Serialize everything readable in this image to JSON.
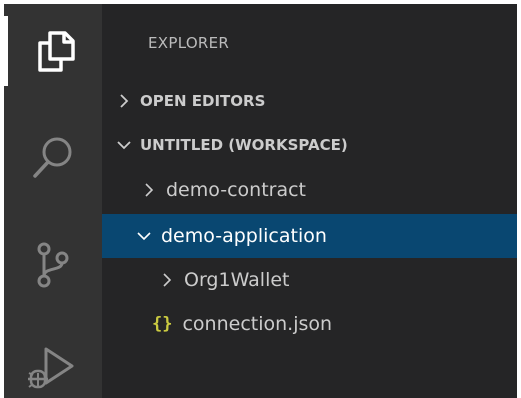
{
  "activity_bar": {
    "items": [
      {
        "name": "explorer",
        "icon": "files-icon",
        "active": true
      },
      {
        "name": "search",
        "icon": "search-icon",
        "active": false
      },
      {
        "name": "source-control",
        "icon": "source-control-icon",
        "active": false
      },
      {
        "name": "run-debug",
        "icon": "run-debug-icon",
        "active": false
      }
    ]
  },
  "sidebar": {
    "title": "EXPLORER",
    "sections": [
      {
        "label": "OPEN EDITORS",
        "expanded": false
      },
      {
        "label": "UNTITLED (WORKSPACE)",
        "expanded": true
      }
    ],
    "tree": [
      {
        "label": "demo-contract",
        "type": "folder",
        "expanded": false,
        "depth": 1
      },
      {
        "label": "demo-application",
        "type": "folder",
        "expanded": true,
        "depth": 1,
        "selected": true
      },
      {
        "label": "Org1Wallet",
        "type": "folder",
        "expanded": false,
        "depth": 2
      },
      {
        "label": "connection.json",
        "type": "file",
        "icon": "json-braces-icon",
        "icon_text": "{}",
        "depth": 2
      }
    ]
  },
  "colors": {
    "activity_bar_bg": "#333333",
    "sidebar_bg": "#252526",
    "selection_bg": "#094771",
    "icon_inactive": "#858585",
    "icon_active": "#ffffff",
    "json_icon": "#cbcb41"
  }
}
